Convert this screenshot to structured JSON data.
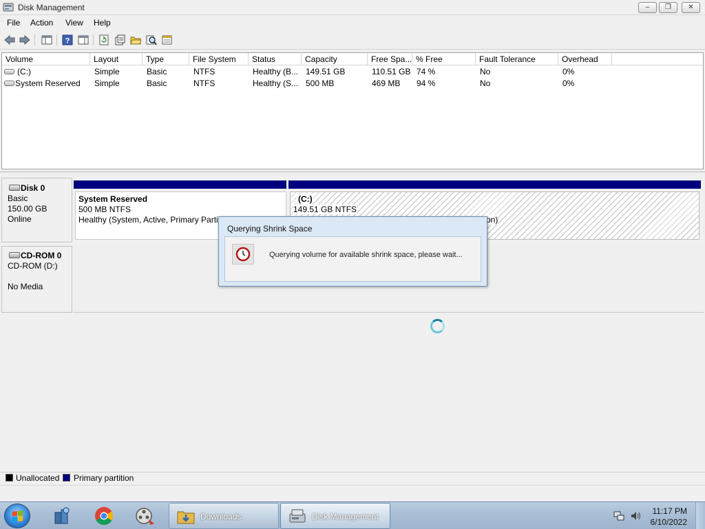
{
  "window": {
    "title": "Disk Management",
    "controls": {
      "minimize": "–",
      "maximize": "❐",
      "close": "✕"
    }
  },
  "menu": [
    "File",
    "Action",
    "View",
    "Help"
  ],
  "toolbar": {
    "icons": [
      "back-icon",
      "forward-icon",
      "console-tree-icon",
      "help-icon",
      "show-hide-icon",
      "refresh-icon",
      "properties-icon",
      "open-icon",
      "search-icon",
      "export-icon"
    ]
  },
  "volume_list": {
    "columns": [
      "Volume",
      "Layout",
      "Type",
      "File System",
      "Status",
      "Capacity",
      "Free Spa...",
      "% Free",
      "Fault Tolerance",
      "Overhead"
    ],
    "rows": [
      {
        "volume": "(C:)",
        "layout": "Simple",
        "type": "Basic",
        "fs": "NTFS",
        "status": "Healthy (B...",
        "capacity": "149.51 GB",
        "free": "110.51 GB",
        "pct": "74 %",
        "fault": "No",
        "overhead": "0%"
      },
      {
        "volume": "System Reserved",
        "layout": "Simple",
        "type": "Basic",
        "fs": "NTFS",
        "status": "Healthy (S...",
        "capacity": "500 MB",
        "free": "469 MB",
        "pct": "94 %",
        "fault": "No",
        "overhead": "0%"
      }
    ]
  },
  "disks": [
    {
      "name": "Disk 0",
      "kind": "Basic",
      "size": "150.00 GB",
      "state": "Online"
    },
    {
      "name": "CD-ROM 0",
      "kind": "CD-ROM (D:)",
      "state": "No Media"
    }
  ],
  "partitions": [
    {
      "name": "System Reserved",
      "fs": "500 MB NTFS",
      "status": "Healthy (System, Active, Primary Partiti"
    },
    {
      "name": "(C:)",
      "fs": "149.51 GB NTFS",
      "status_tail": "on)"
    }
  ],
  "dialog": {
    "title": "Querying Shrink Space",
    "message": "Querying volume for available shrink space, please wait..."
  },
  "legend": [
    {
      "label": "Unallocated",
      "color": "#000000"
    },
    {
      "label": "Primary partition",
      "color": "#00007f"
    }
  ],
  "taskbar": {
    "buttons": [
      {
        "label": "Downloads"
      },
      {
        "label": "Disk Management"
      }
    ],
    "time": "11:17 PM",
    "date": "6/10/2022"
  },
  "colors": {
    "primary_partition": "#00007f",
    "dialog_frame": "#dbe8f5"
  }
}
